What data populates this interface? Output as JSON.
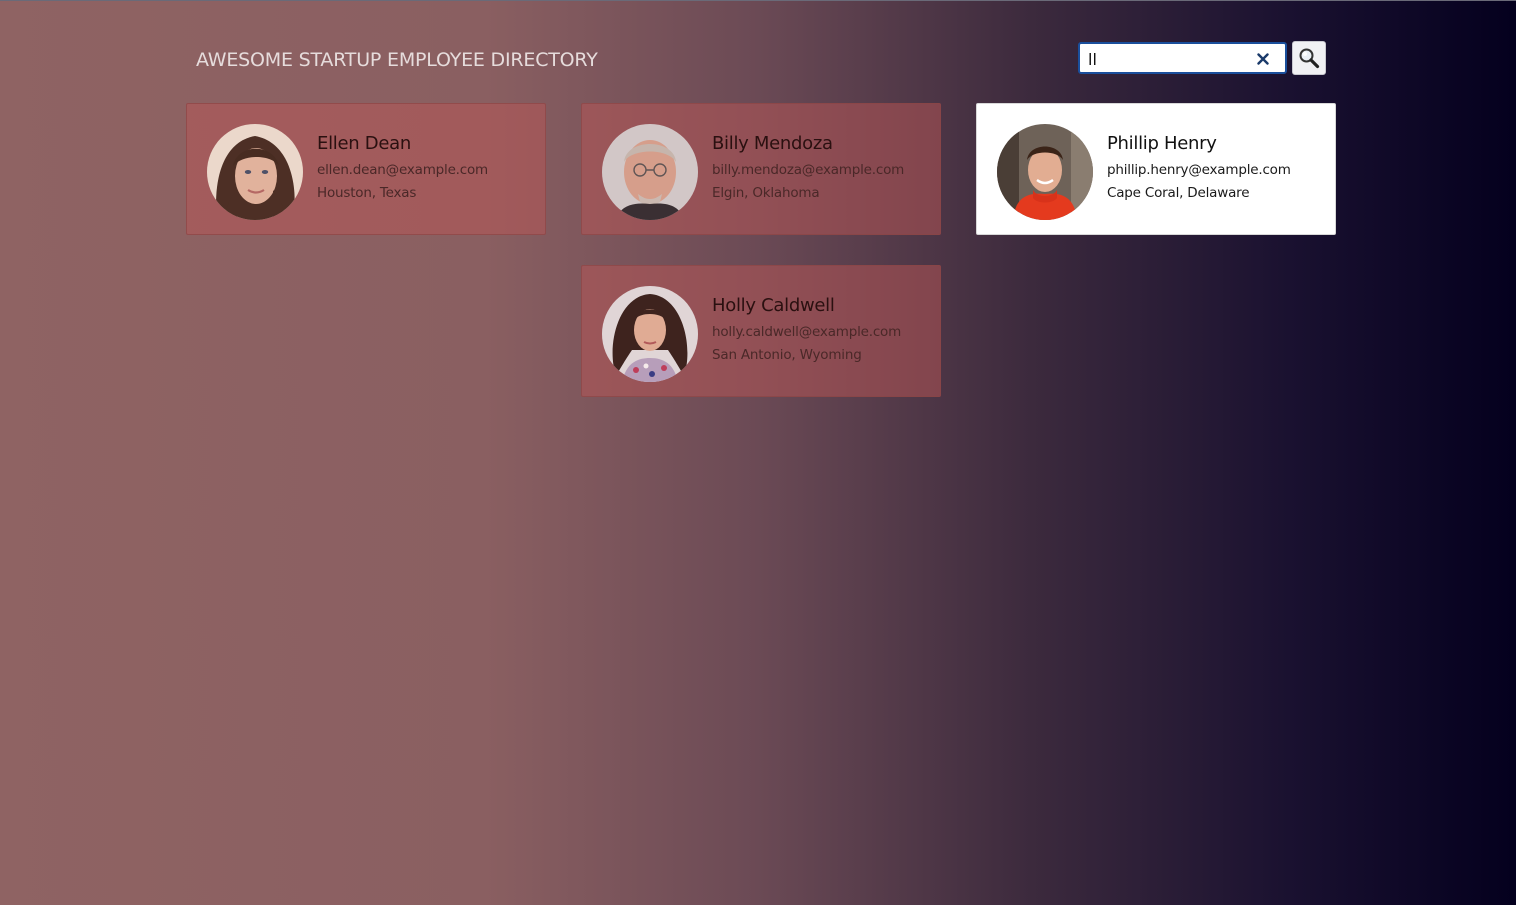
{
  "header": {
    "title": "AWESOME STARTUP EMPLOYEE DIRECTORY"
  },
  "search": {
    "value": "ll",
    "placeholder": "",
    "clear_icon": "close-icon",
    "button_icon": "search-icon"
  },
  "employees": [
    {
      "name": "Ellen Dean",
      "email": "ellen.dean@example.com",
      "location": "Houston, Texas",
      "highlighted": false
    },
    {
      "name": "Billy Mendoza",
      "email": "billy.mendoza@example.com",
      "location": "Elgin, Oklahoma",
      "highlighted": false
    },
    {
      "name": "Phillip Henry",
      "email": "phillip.henry@example.com",
      "location": "Cape Coral, Delaware",
      "highlighted": true
    },
    {
      "name": "Holly Caldwell",
      "email": "holly.caldwell@example.com",
      "location": "San Antonio, Wyoming",
      "highlighted": false
    }
  ],
  "colors": {
    "search_border": "#1a4f9c",
    "card_highlight": "#ffffff",
    "card_dim": "#b95555"
  }
}
